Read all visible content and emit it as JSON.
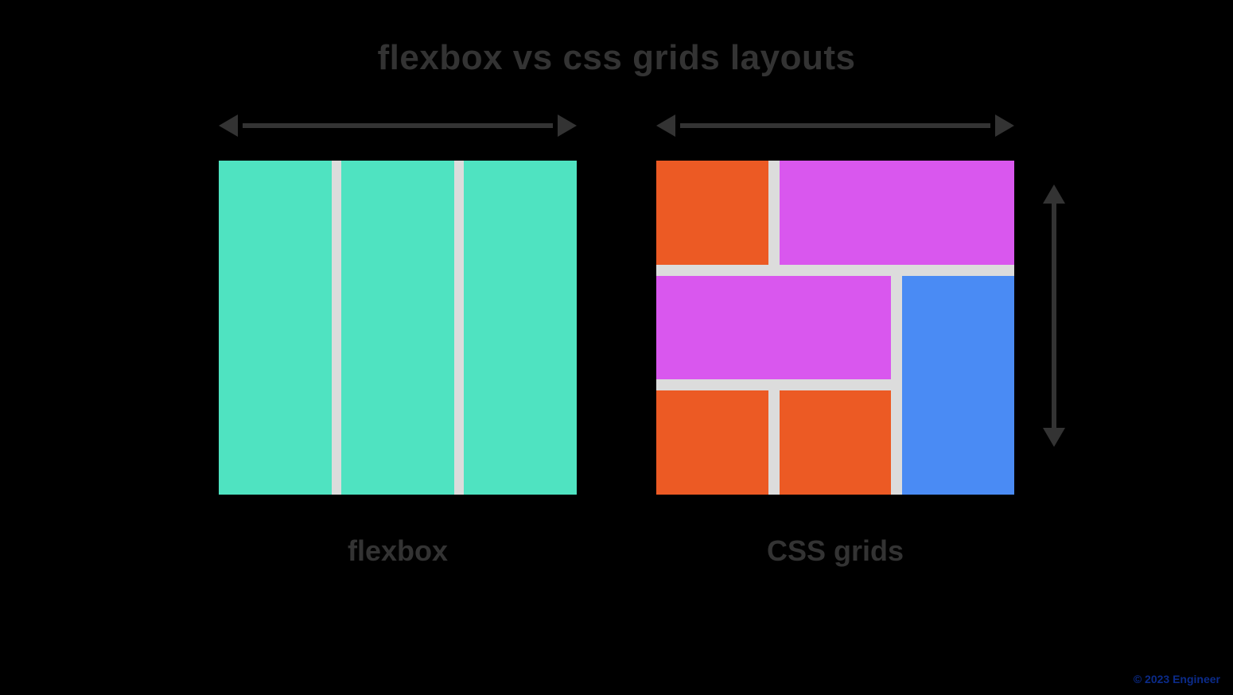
{
  "title": "flexbox vs css grids layouts",
  "left": {
    "caption": "flexbox",
    "columns": 3,
    "column_color": "#4fe3c1",
    "bg_color": "#dcdcdc"
  },
  "right": {
    "caption": "CSS grids",
    "bg_color": "#dcdcdc",
    "cells": [
      {
        "name": "g1",
        "color": "#ec5a24"
      },
      {
        "name": "g2",
        "color": "#d957ee"
      },
      {
        "name": "g3",
        "color": "#d957ee"
      },
      {
        "name": "g4",
        "color": "#4a8bf4"
      },
      {
        "name": "g5",
        "color": "#ec5a24"
      },
      {
        "name": "g6",
        "color": "#ec5a24"
      }
    ]
  },
  "arrow_color": "#333333",
  "watermark": "© 2023 Engineer"
}
